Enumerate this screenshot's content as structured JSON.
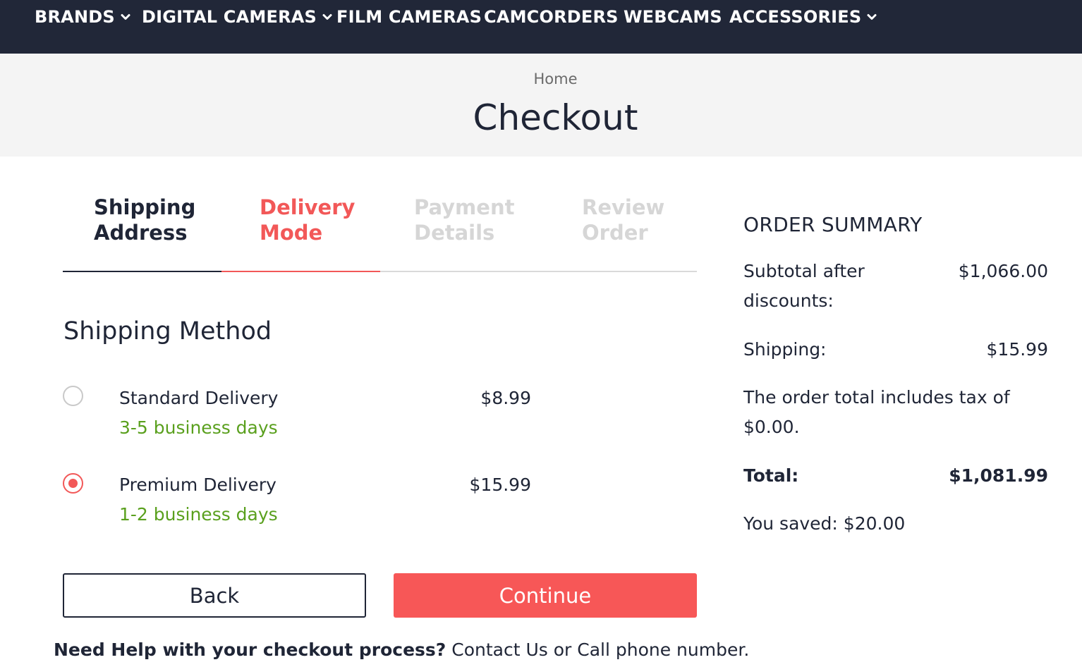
{
  "nav": {
    "items": [
      {
        "label": "BRANDS",
        "dropdown": true
      },
      {
        "label": "DIGITAL CAMERAS",
        "dropdown": true
      },
      {
        "label": "FILM CAMERAS",
        "dropdown": false
      },
      {
        "label": "CAMCORDERS",
        "dropdown": false
      },
      {
        "label": "WEBCAMS",
        "dropdown": false
      },
      {
        "label": "ACCESSORIES",
        "dropdown": true
      }
    ]
  },
  "header": {
    "breadcrumb": "Home",
    "title": "Checkout"
  },
  "steps": [
    {
      "line1": "Shipping",
      "line2": "Address",
      "state": "done"
    },
    {
      "line1": "Delivery",
      "line2": "Mode",
      "state": "active"
    },
    {
      "line1": "Payment",
      "line2": "Details",
      "state": "todo"
    },
    {
      "line1": "Review",
      "line2": "Order",
      "state": "todo"
    }
  ],
  "shipping": {
    "title": "Shipping Method",
    "options": [
      {
        "name": "Standard Delivery",
        "days": "3-5 business days",
        "price": "$8.99",
        "selected": false
      },
      {
        "name": "Premium Delivery",
        "days": "1-2 business days",
        "price": "$15.99",
        "selected": true
      }
    ]
  },
  "buttons": {
    "back": "Back",
    "continue": "Continue"
  },
  "help": {
    "bold": "Need Help with your checkout process?",
    "text": " Contact Us or Call phone number."
  },
  "summary": {
    "title": "ORDER SUMMARY",
    "subtotal_label_1": "Subtotal after",
    "subtotal_label_2": "discounts:",
    "subtotal_value": "$1,066.00",
    "shipping_label": "Shipping:",
    "shipping_value": "$15.99",
    "tax_note_1": "The order total includes tax of",
    "tax_note_2": "$0.00.",
    "total_label": "Total:",
    "total_value": "$1,081.99",
    "saved": "You saved: $20.00"
  },
  "colors": {
    "nav_bg": "#212738",
    "accent": "#f25858",
    "success": "#5aa01e",
    "muted": "#d6d6d6"
  }
}
